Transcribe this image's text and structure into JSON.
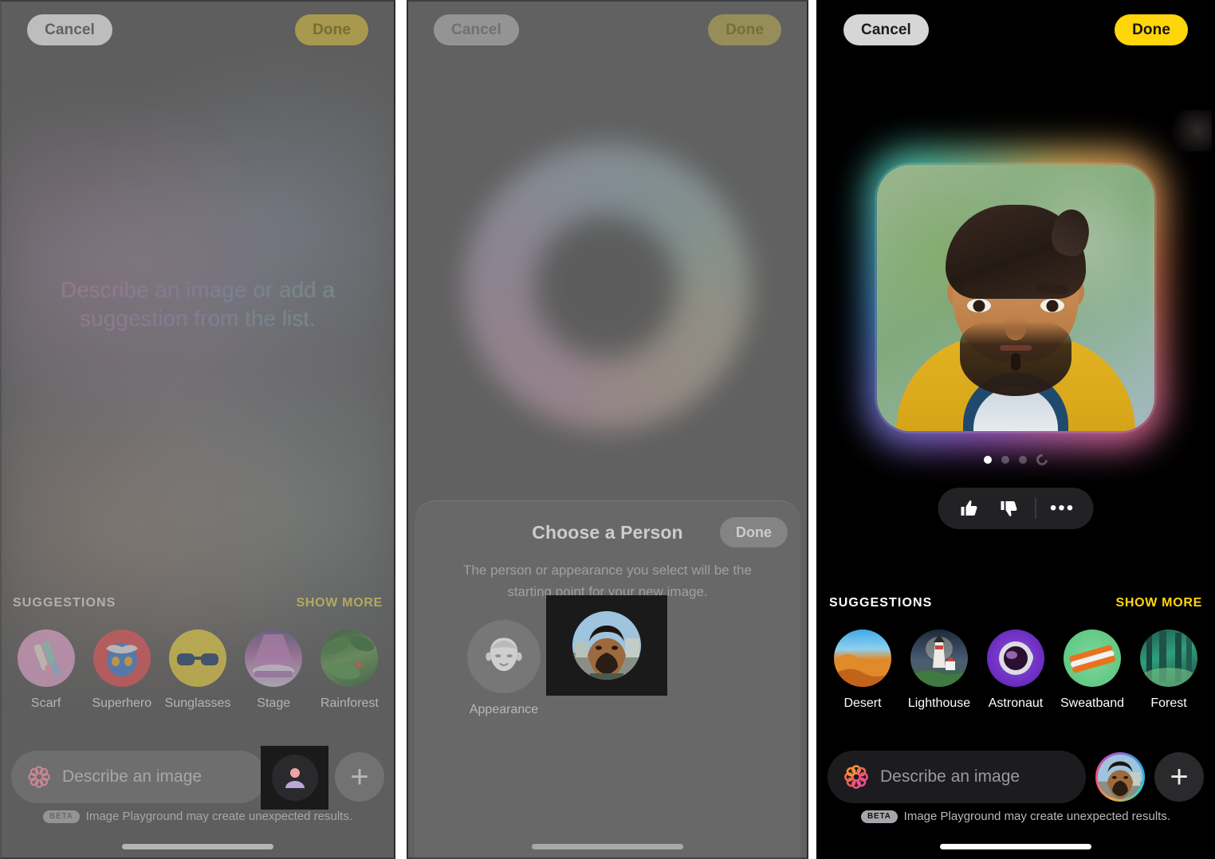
{
  "panels": [
    {
      "id": "panel-describe",
      "state": "dimmed",
      "topbar": {
        "cancel": "Cancel",
        "done": "Done"
      },
      "hero_text": "Describe an image or add a suggestion from the list.",
      "suggestions": {
        "header": "SUGGESTIONS",
        "show_more": "SHOW MORE",
        "items": [
          {
            "label": "Scarf",
            "art": "art-scarf",
            "icon": "scarf-icon"
          },
          {
            "label": "Superhero",
            "art": "art-superhero",
            "icon": "superhero-mask-icon"
          },
          {
            "label": "Sunglasses",
            "art": "art-sunglasses",
            "icon": "sunglasses-icon"
          },
          {
            "label": "Stage",
            "art": "art-stage",
            "icon": "stage-lights-icon"
          },
          {
            "label": "Rainforest",
            "art": "art-rainforest",
            "icon": "rainforest-icon"
          }
        ]
      },
      "input": {
        "placeholder": "Describe an image",
        "value": "",
        "leading_icon": "apple-intelligence-icon",
        "person_button_icon": "person-icon",
        "add_button_icon": "plus-icon"
      },
      "footer": {
        "badge": "BETA",
        "text": "Image Playground may create unexpected results."
      }
    },
    {
      "id": "panel-choose-person",
      "state": "dimmed",
      "topbar": {
        "cancel": "Cancel",
        "done": "Done"
      },
      "sheet": {
        "title": "Choose a Person",
        "done": "Done",
        "subtitle": "The person or appearance you select will be the starting point for your new image.",
        "options": [
          {
            "label": "Appearance",
            "icon": "appearance-face-icon"
          },
          {
            "label": "",
            "icon": "person-photo-avatar"
          }
        ]
      }
    },
    {
      "id": "panel-result",
      "state": "active",
      "topbar": {
        "cancel": "Cancel",
        "done": "Done"
      },
      "result": {
        "image_alt": "generated-cartoon-portrait",
        "pagination": {
          "total_dots": 4,
          "active_index": 0,
          "refresh_icon": "refresh-icon"
        },
        "actions": [
          {
            "name": "thumbs-up",
            "icon": "thumbs-up-icon"
          },
          {
            "name": "thumbs-down",
            "icon": "thumbs-down-icon"
          },
          {
            "name": "more-options",
            "icon": "ellipsis-icon"
          }
        ]
      },
      "suggestions": {
        "header": "SUGGESTIONS",
        "show_more": "SHOW MORE",
        "items": [
          {
            "label": "Desert",
            "art": "art-desert",
            "icon": "desert-dune-icon"
          },
          {
            "label": "Lighthouse",
            "art": "art-lighthouse",
            "icon": "lighthouse-icon"
          },
          {
            "label": "Astronaut",
            "art": "art-astronaut",
            "icon": "astronaut-helmet-icon"
          },
          {
            "label": "Sweatband",
            "art": "art-sweatband",
            "icon": "sweatband-icon"
          },
          {
            "label": "Forest",
            "art": "art-forest",
            "icon": "forest-icon"
          }
        ]
      },
      "input": {
        "placeholder": "Describe an image",
        "value": "",
        "leading_icon": "apple-intelligence-icon",
        "avatar_icon": "user-avatar",
        "add_button_icon": "plus-icon"
      },
      "footer": {
        "badge": "BETA",
        "text": "Image Playground may create unexpected results."
      }
    }
  ],
  "colors": {
    "accent_yellow": "#ffd60a",
    "panel_dim_bg": "#646464",
    "panel_dark_bg": "#000000",
    "field_dark": "#1c1c1e"
  }
}
